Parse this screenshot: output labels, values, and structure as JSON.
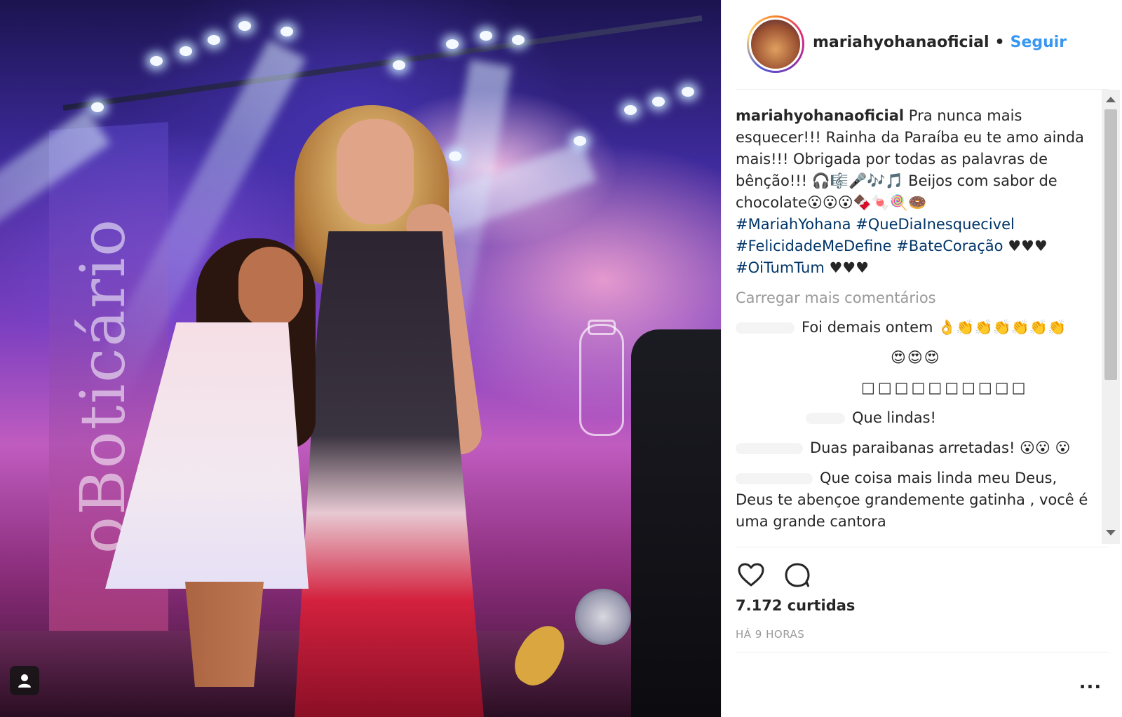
{
  "post": {
    "username": "mariahyohanaoficial",
    "follow_label": "Seguir",
    "separator": "•",
    "caption": {
      "text_1": "Pra nunca mais esquecer!!! Rainha da Paraíba eu te amo ainda mais!!! Obrigada por todas as palavras de bênção!!! 🎧🎼🎤🎶🎵 Beijos com sabor de chocolate😮😮😮🍫🍬🍭🍩",
      "hashtags_1": "#MariahYohana #QueDiaInesquecivel",
      "hashtags_2": "#FelicidadeMeDefine #BateCoração",
      "hearts_1": " ♥♥♥",
      "hashtags_3": "#OiTumTum",
      "hearts_2": " ♥♥♥"
    },
    "load_more_label": "Carregar mais comentários",
    "comments": [
      {
        "text": "Foi demais ontem 👌👏👏👏👏👏👏"
      },
      {
        "text": "😍😍😍"
      },
      {
        "text": "□□□□□□□□□□"
      },
      {
        "text": "Que lindas!"
      },
      {
        "text": "Duas paraibanas arretadas! 😮😮 😮"
      },
      {
        "text": "Que coisa mais linda meu Deus, Deus te abençoe grandemente gatinha , você é uma grande cantora"
      }
    ],
    "likes_label": "7.172 curtidas",
    "time_label": "HÁ 9 HORAS",
    "more_label": "..."
  },
  "icons": {
    "like": "heart-icon",
    "comment": "comment-bubble-icon",
    "profile": "user-silhouette-icon",
    "more": "ellipsis-icon"
  },
  "colors": {
    "link_blue": "#3897f0",
    "hashtag": "#003569",
    "muted": "#999999",
    "text": "#262626"
  }
}
